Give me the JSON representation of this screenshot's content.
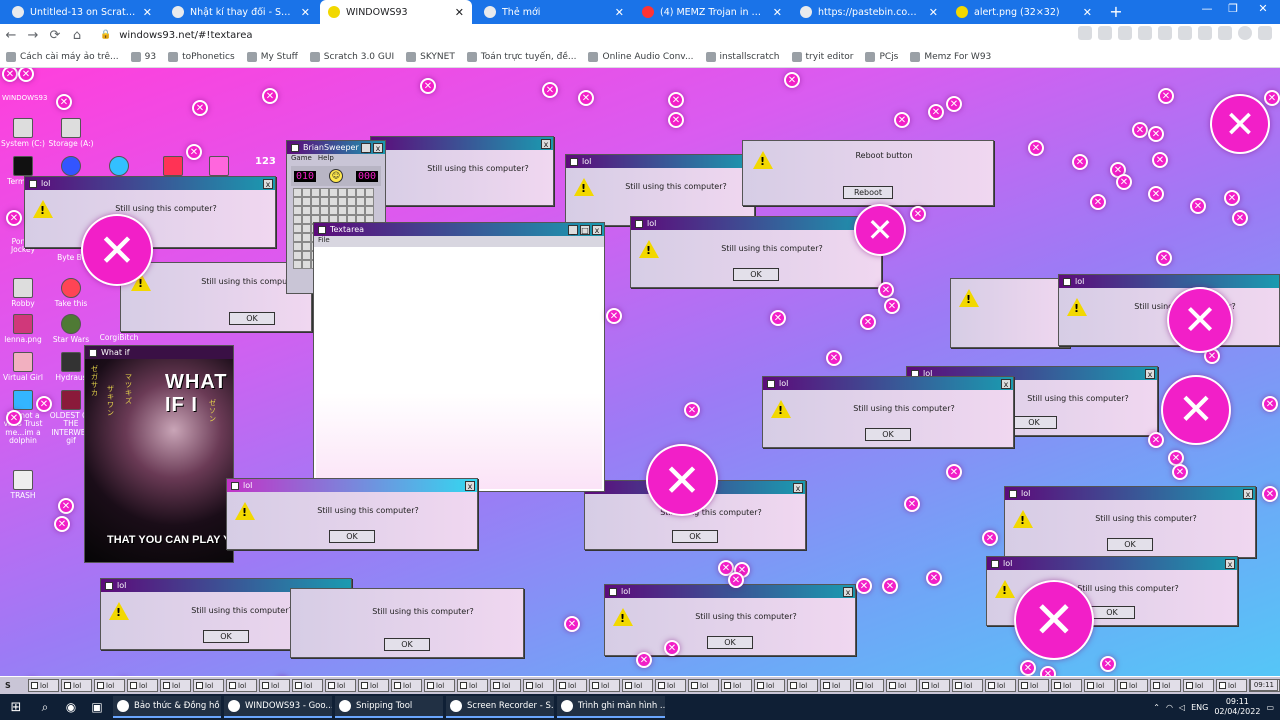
{
  "browser": {
    "tabs": [
      {
        "label": "Untitled-13 on Scratch",
        "active": false
      },
      {
        "label": "Nhật kí thay đổi - Scratch Addo",
        "active": false
      },
      {
        "label": "WINDOWS93",
        "active": true
      },
      {
        "label": "Thẻ mới",
        "active": false
      },
      {
        "label": "(4) MEMZ Trojan in Windows 93",
        "active": false
      },
      {
        "label": "https://pastebin.com/raw/3R1v",
        "active": false
      },
      {
        "label": "alert.png (32×32)",
        "active": false
      }
    ],
    "new_tab": "+",
    "window_controls": [
      "—",
      "❐",
      "✕"
    ],
    "url": "windows93.net/#!textarea",
    "nav": [
      "←",
      "→",
      "⟳",
      "⌂"
    ],
    "bookmarks": [
      "Cách cài máy ảo trê...",
      "93",
      "toPhonetics",
      "My Stuff",
      "Scratch 3.0 GUI",
      "SKYNET",
      "Toán trực tuyến, đề...",
      "Online Audio Conv...",
      "installscratch",
      "tryit editor",
      "PCjs",
      "Memz For W93"
    ]
  },
  "desktop": {
    "os_label": "WINDOWS93",
    "icons": [
      "System (C:)",
      "Storage (A:)",
      "Terminal",
      "Poney Jockey",
      "Byte Br",
      "Robby",
      "Take this",
      "lenna.png",
      "Star Wars",
      "CorgiBitch",
      "Virtual Girl",
      "Hydraus",
      "i'm not a virus Trust me...im a dolphin",
      "OLDEST OF THE INTERWEB gif",
      "TRASH"
    ],
    "icon_glyph_label": "123"
  },
  "alert": {
    "title": "lol",
    "message": "Still using this computer?",
    "ok": "OK",
    "reboot_message": "Reboot button",
    "reboot_button": "Reboot",
    "close": "x"
  },
  "minesweeper": {
    "title": "BrianSweeper",
    "menu": [
      "Game",
      "Help"
    ],
    "mines_left": "010",
    "timer": "000",
    "face": "☺"
  },
  "textarea_app": {
    "title": "Textarea",
    "menu": "File"
  },
  "whatif": {
    "title": "What if",
    "top_text": "WHAT IF I",
    "bottom_text": "THAT YOU CAN PLAY YO",
    "matrix_text": [
      "ゼガサカ",
      "ザキワン",
      "マツキズ",
      "ゼソン"
    ]
  },
  "w93_taskbar": {
    "start": "S",
    "task_label": "lol",
    "clock": "09:11"
  },
  "win_taskbar": {
    "apps": [
      "Bảo thức & Đồng hồ",
      "WINDOWS93 - Goo...",
      "Snipping Tool",
      "Screen Recorder - S...",
      "Trình ghi màn hình ..."
    ],
    "language": "ENG",
    "time": "09:11",
    "date": "02/04/2022"
  },
  "colors": {
    "chrome_tabstrip": "#1a73e8",
    "desktop_pink": "#ff3fdc",
    "desktop_blue": "#55c6f7",
    "xmark": "#f21fc8"
  }
}
